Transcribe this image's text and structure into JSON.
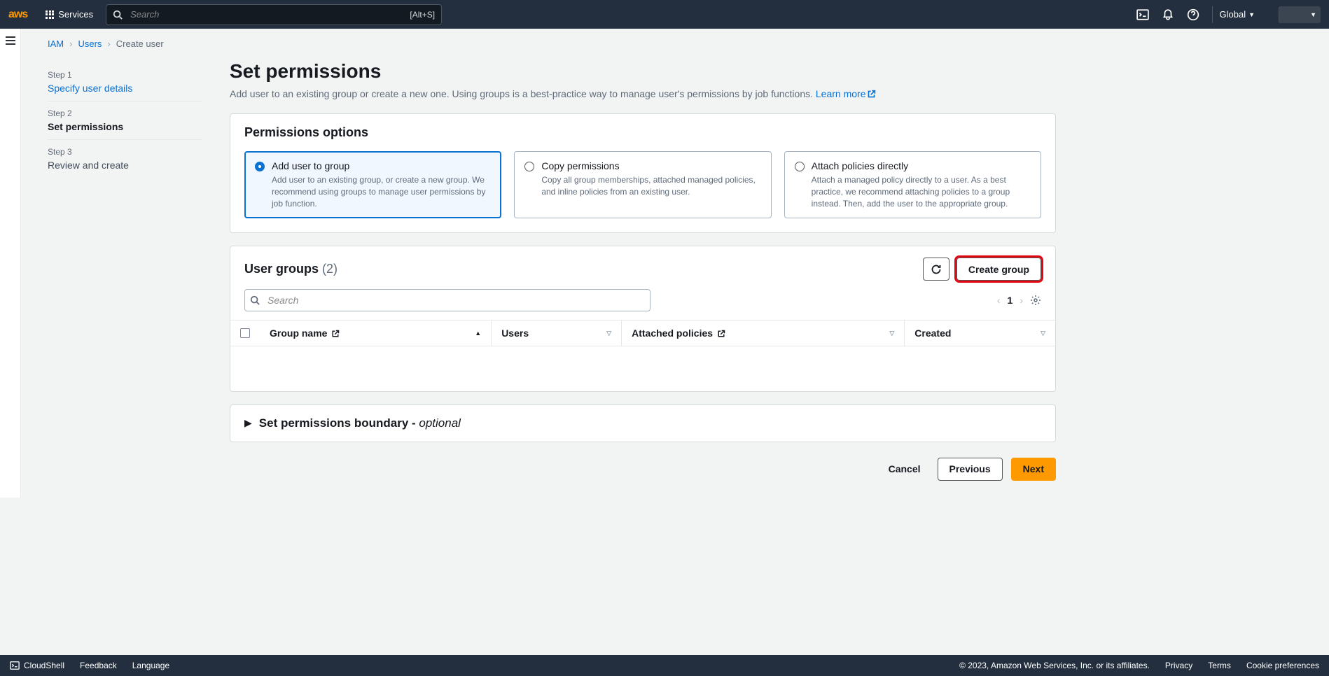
{
  "topnav": {
    "services": "Services",
    "search_placeholder": "Search",
    "shortcut": "[Alt+S]",
    "region": "Global"
  },
  "breadcrumb": {
    "iam": "IAM",
    "users": "Users",
    "current": "Create user"
  },
  "steps": {
    "s1_label": "Step 1",
    "s1_title": "Specify user details",
    "s2_label": "Step 2",
    "s2_title": "Set permissions",
    "s3_label": "Step 3",
    "s3_title": "Review and create"
  },
  "page": {
    "title": "Set permissions",
    "desc": "Add user to an existing group or create a new one. Using groups is a best-practice way to manage user's permissions by job functions.",
    "learn_more": "Learn more"
  },
  "perms": {
    "header": "Permissions options",
    "opt1_title": "Add user to group",
    "opt1_desc": "Add user to an existing group, or create a new group. We recommend using groups to manage user permissions by job function.",
    "opt2_title": "Copy permissions",
    "opt2_desc": "Copy all group memberships, attached managed policies, and inline policies from an existing user.",
    "opt3_title": "Attach policies directly",
    "opt3_desc": "Attach a managed policy directly to a user. As a best practice, we recommend attaching policies to a group instead. Then, add the user to the appropriate group."
  },
  "groups": {
    "title": "User groups",
    "count": "(2)",
    "create": "Create group",
    "search_placeholder": "Search",
    "page": "1",
    "cols": {
      "name": "Group name",
      "users": "Users",
      "policies": "Attached policies",
      "created": "Created"
    }
  },
  "boundary": {
    "title_a": "Set permissions boundary - ",
    "title_b": "optional"
  },
  "footer": {
    "cancel": "Cancel",
    "previous": "Previous",
    "next": "Next"
  },
  "bottom": {
    "cloudshell": "CloudShell",
    "feedback": "Feedback",
    "language": "Language",
    "copyright": "© 2023, Amazon Web Services, Inc. or its affiliates.",
    "privacy": "Privacy",
    "terms": "Terms",
    "cookies": "Cookie preferences"
  }
}
